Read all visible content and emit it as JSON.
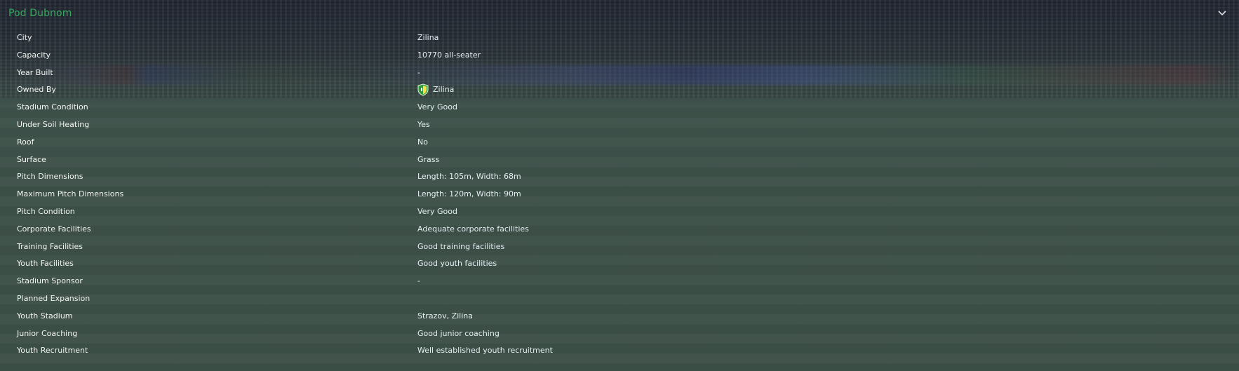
{
  "panel": {
    "title": "Pod Dubnom",
    "collapse_icon": "chevron-down-icon",
    "accent_color": "#39a862"
  },
  "rows": [
    {
      "label": "City",
      "value": "Zilina"
    },
    {
      "label": "Capacity",
      "value": "10770 all-seater"
    },
    {
      "label": "Year Built",
      "value": "-"
    },
    {
      "label": "Owned By",
      "value": "Zilina",
      "icon": "club-crest-icon"
    },
    {
      "label": "Stadium Condition",
      "value": "Very Good"
    },
    {
      "label": "Under Soil Heating",
      "value": "Yes"
    },
    {
      "label": "Roof",
      "value": "No"
    },
    {
      "label": "Surface",
      "value": "Grass"
    },
    {
      "label": "Pitch Dimensions",
      "value": "Length: 105m, Width: 68m"
    },
    {
      "label": "Maximum Pitch Dimensions",
      "value": "Length: 120m, Width: 90m"
    },
    {
      "label": "Pitch Condition",
      "value": "Very Good"
    },
    {
      "label": "Corporate Facilities",
      "value": "Adequate corporate facilities"
    },
    {
      "label": "Training Facilities",
      "value": "Good training facilities"
    },
    {
      "label": "Youth Facilities",
      "value": "Good youth facilities"
    },
    {
      "label": "Stadium Sponsor",
      "value": "-"
    },
    {
      "label": "Planned Expansion",
      "value": ""
    },
    {
      "label": "Youth Stadium",
      "value": "Strazov, Zilina"
    },
    {
      "label": "Junior Coaching",
      "value": "Good junior coaching"
    },
    {
      "label": "Youth Recruitment",
      "value": "Well established youth recruitment"
    }
  ]
}
